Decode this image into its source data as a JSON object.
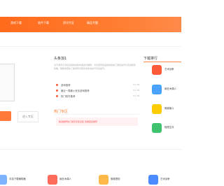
{
  "nav": {
    "items": [
      "游戏下载",
      "软件下载",
      "资讯专区",
      "精品专题"
    ]
  },
  "left": {
    "secondary_button": "进入专区"
  },
  "middle": {
    "title": "头条加1",
    "description": "关于游戏与手机应用的最新内容资讯推荐，为玩家带来最新鲜的热门游戏资讯与实用软件攻略，帮助你更快了解游戏与软件的新动态与玩法技巧。",
    "news": [
      {
        "text": "游戏推荐",
        "date": "01-18"
      },
      {
        "text": "最近一周最火安全游戏推荐",
        "date": "01-18"
      },
      {
        "text": "热门软件推荐",
        "date": "01-18"
      }
    ],
    "hot_title": "热门专区",
    "hot_text": "精选推荐热门游戏专区合集 查看更多推荐"
  },
  "rank": {
    "title": "下载排行",
    "items": [
      {
        "name": "艺术战争",
        "color": "#ff5a3a"
      },
      {
        "name": "疯狂木偶人",
        "color": "#4aa3ff"
      },
      {
        "name": "像素格斗",
        "color": "#ffcc00"
      },
      {
        "name": "极限生存",
        "color": "#3fc26d"
      }
    ]
  },
  "bottom": {
    "items": [
      {
        "name": "手游下载辅助器",
        "color": "#7db3ff"
      },
      {
        "name": "疯狂木偶人",
        "color": "#ff6b5a"
      },
      {
        "name": "像素冒险",
        "color": "#ffb84a"
      },
      {
        "name": "艺术战争",
        "color": "#4a8bff"
      }
    ]
  }
}
